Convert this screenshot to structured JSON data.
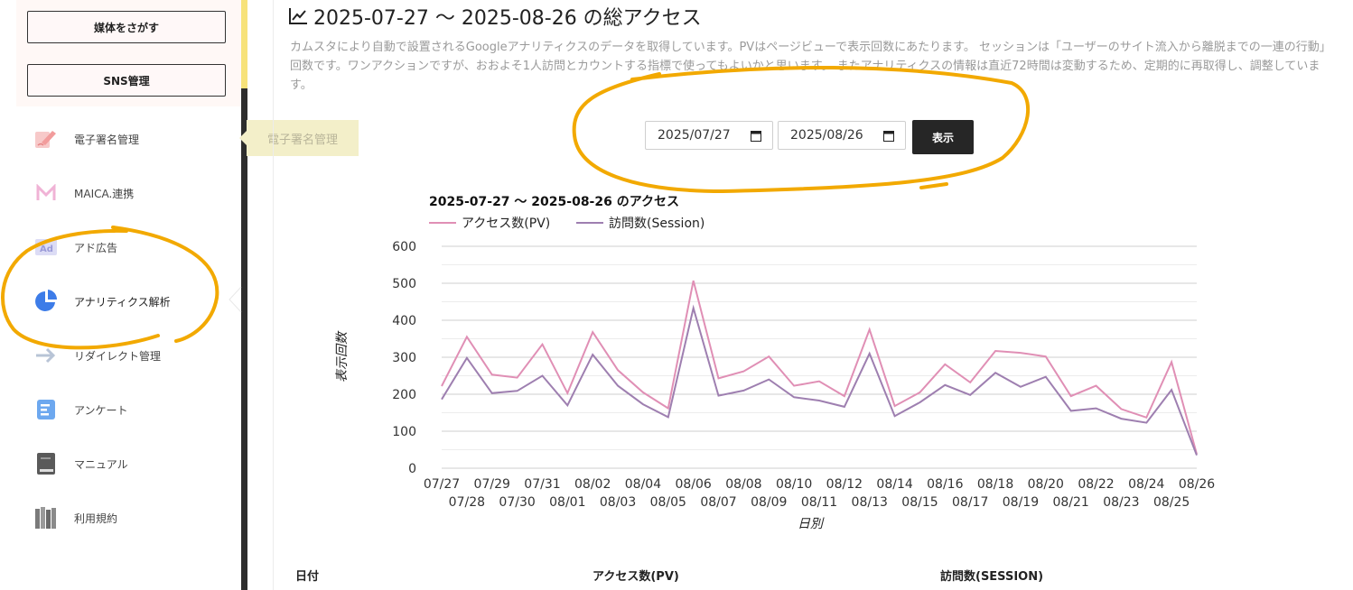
{
  "sidebar": {
    "buttons": [
      {
        "label": "媒体をさがす"
      },
      {
        "label": "SNS管理"
      }
    ],
    "items": [
      {
        "label": "電子署名管理",
        "icon": "pen-sign-icon"
      },
      {
        "label": "MAICA.連携",
        "icon": "maica-m-icon"
      },
      {
        "label": "アド広告",
        "icon": "ad-icon"
      },
      {
        "label": "アナリティクス解析",
        "icon": "pie-chart-icon"
      },
      {
        "label": "リダイレクト管理",
        "icon": "redirect-arrow-icon"
      },
      {
        "label": "アンケート",
        "icon": "survey-icon"
      },
      {
        "label": "マニュアル",
        "icon": "book-icon"
      },
      {
        "label": "利用規約",
        "icon": "books-icon"
      }
    ],
    "tooltip": "電子署名管理"
  },
  "main": {
    "title": "2025-07-27 〜 2025-08-26 の総アクセス",
    "description": "カムスタにより自動で設置されるGoogleアナリティクスのデータを取得しています。PVはページビューで表示回数にあたります。 セッションは「ユーザーのサイト流入から離脱までの一連の行動」回数です。ワンアクションですが、おおよそ1人訪問とカウントする指標で使ってもよいかと思います。 またアナリティクスの情報は直近72時間は変動するため、定期的に再取得し、調整しています。",
    "date_from": "2025/07/27",
    "date_to": "2025/08/26",
    "show_button": "表示",
    "table_headers": [
      "日付",
      "アクセス数(PV)",
      "訪問数(SESSION)"
    ]
  },
  "colors": {
    "pv": "#e08fb5",
    "session": "#9e7fb0",
    "annotation": "#f2a900"
  },
  "chart_data": {
    "type": "line",
    "title": "2025-07-27 〜 2025-08-26 のアクセス",
    "xlabel": "日別",
    "ylabel": "表示回数",
    "ylim": [
      0,
      600
    ],
    "yticks": [
      0,
      100,
      200,
      300,
      400,
      500,
      600
    ],
    "grid": true,
    "legend": "top-left",
    "categories": [
      "07/27",
      "07/28",
      "07/29",
      "07/30",
      "07/31",
      "08/01",
      "08/02",
      "08/03",
      "08/04",
      "08/05",
      "08/06",
      "08/07",
      "08/08",
      "08/09",
      "08/10",
      "08/11",
      "08/12",
      "08/13",
      "08/14",
      "08/15",
      "08/16",
      "08/17",
      "08/18",
      "08/19",
      "08/20",
      "08/21",
      "08/22",
      "08/23",
      "08/24",
      "08/25",
      "08/26"
    ],
    "series": [
      {
        "name": "アクセス数(PV)",
        "values": [
          222,
          355,
          253,
          245,
          335,
          203,
          368,
          265,
          205,
          162,
          507,
          243,
          262,
          302,
          223,
          235,
          195,
          375,
          168,
          205,
          281,
          232,
          317,
          312,
          302,
          195,
          223,
          160,
          137,
          287,
          38
        ]
      },
      {
        "name": "訪問数(Session)",
        "values": [
          186,
          298,
          203,
          209,
          250,
          170,
          307,
          223,
          173,
          138,
          433,
          196,
          210,
          240,
          192,
          183,
          166,
          310,
          141,
          178,
          225,
          198,
          258,
          220,
          247,
          155,
          162,
          134,
          123,
          212,
          35
        ]
      }
    ]
  }
}
